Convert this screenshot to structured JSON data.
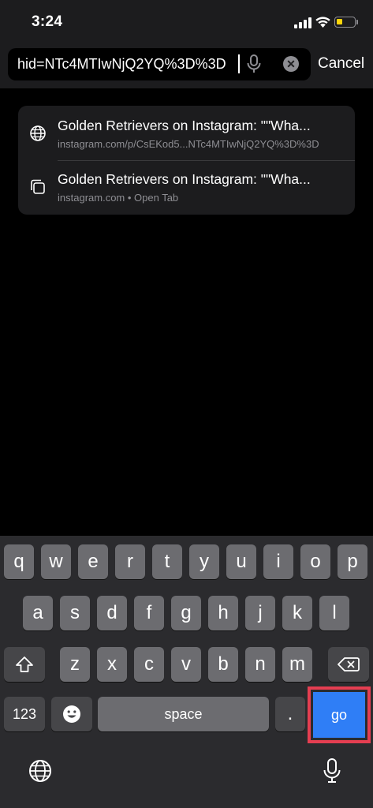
{
  "status": {
    "time": "3:24"
  },
  "search": {
    "url_text": "hid=NTc4MTIwNjQ2YQ%3D%3D",
    "cancel_label": "Cancel"
  },
  "suggestions": [
    {
      "title": "Golden Retrievers on Instagram: \"\"Wha...",
      "subtitle": "instagram.com/p/CsEKod5...NTc4MTIwNjQ2YQ%3D%3D",
      "icon": "globe-icon"
    },
    {
      "title": "Golden Retrievers on Instagram: \"\"Wha...",
      "subtitle": "instagram.com • Open Tab",
      "icon": "tabs-icon"
    }
  ],
  "keyboard": {
    "row1": [
      "q",
      "w",
      "e",
      "r",
      "t",
      "y",
      "u",
      "i",
      "o",
      "p"
    ],
    "row2": [
      "a",
      "s",
      "d",
      "f",
      "g",
      "h",
      "j",
      "k",
      "l"
    ],
    "row3": [
      "z",
      "x",
      "c",
      "v",
      "b",
      "n",
      "m"
    ],
    "num_label": "123",
    "space_label": "space",
    "period_label": ".",
    "go_label": "go"
  },
  "colors": {
    "background": "#000000",
    "bar": "#1c1c1e",
    "key": "#6c6c70",
    "go_button": "#2f7ef6",
    "highlight_frame": "#e53e51"
  }
}
